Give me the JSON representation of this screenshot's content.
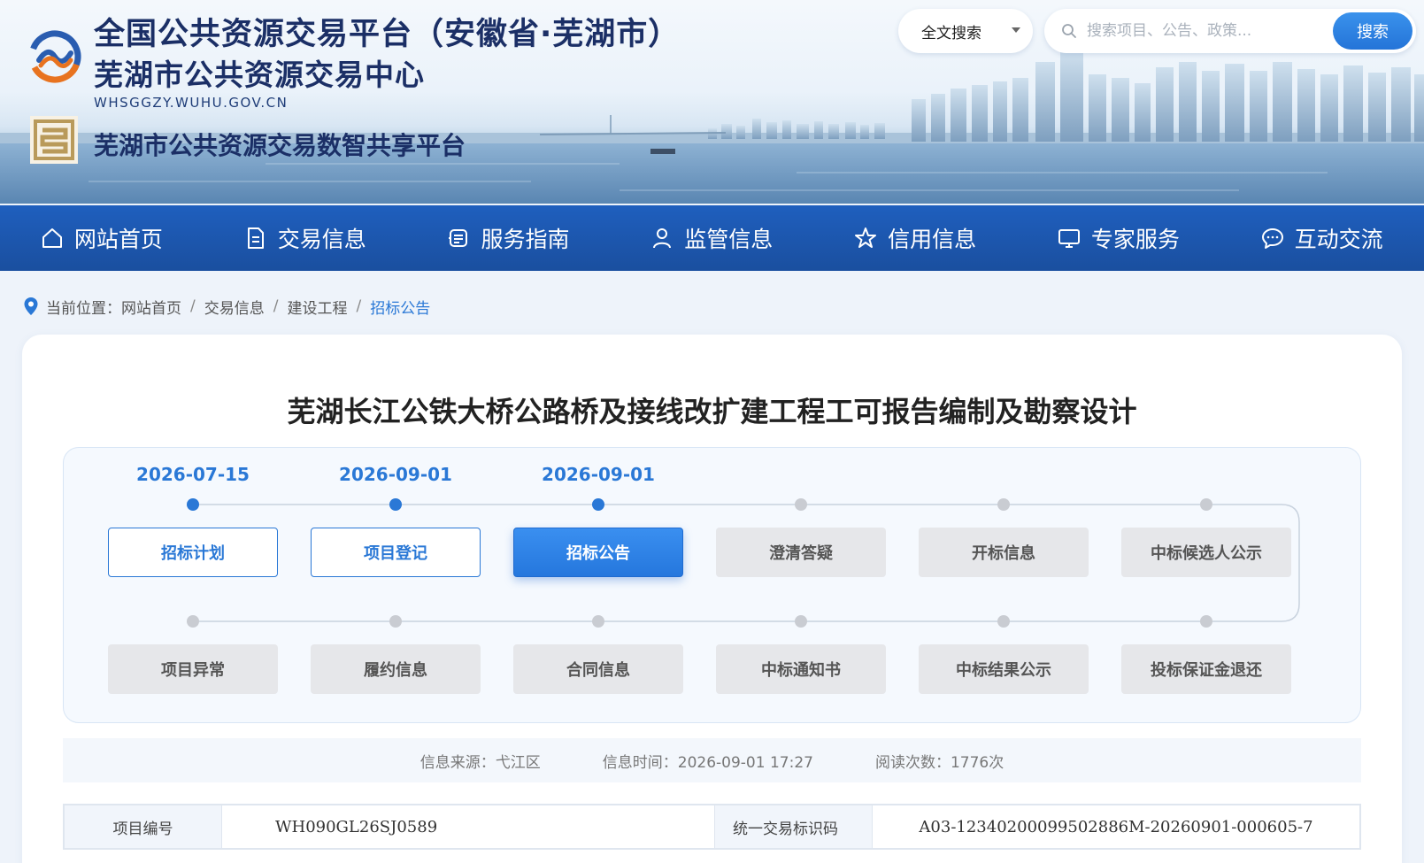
{
  "header": {
    "title_main": "全国公共资源交易平台（安徽省·芜湖市）",
    "title_sub": "芜湖市公共资源交易中心",
    "domain": "WHSGGZY.WUHU.GOV.CN",
    "title_share": "芜湖市公共资源交易数智共享平台"
  },
  "search": {
    "type_label": "全文搜索",
    "placeholder": "搜索项目、公告、政策...",
    "button_label": "搜索"
  },
  "nav": {
    "items": [
      {
        "label": "网站首页",
        "icon": "home-icon"
      },
      {
        "label": "交易信息",
        "icon": "document-icon"
      },
      {
        "label": "服务指南",
        "icon": "guide-icon"
      },
      {
        "label": "监管信息",
        "icon": "user-icon"
      },
      {
        "label": "信用信息",
        "icon": "star-icon"
      },
      {
        "label": "专家服务",
        "icon": "monitor-icon"
      },
      {
        "label": "互动交流",
        "icon": "chat-icon"
      }
    ]
  },
  "breadcrumb": {
    "prefix": "当前位置：",
    "items": [
      "网站首页",
      "交易信息",
      "建设工程"
    ],
    "current": "招标公告",
    "separator": "/"
  },
  "document": {
    "title": "芜湖长江公铁大桥公路桥及接线改扩建工程工可报告编制及勘察设计"
  },
  "flow": {
    "row1": [
      {
        "label": "招标计划",
        "date": "2026-07-15",
        "state": "done"
      },
      {
        "label": "项目登记",
        "date": "2026-09-01",
        "state": "done"
      },
      {
        "label": "招标公告",
        "date": "2026-09-01",
        "state": "active"
      },
      {
        "label": "澄清答疑",
        "date": "",
        "state": "todo"
      },
      {
        "label": "开标信息",
        "date": "",
        "state": "todo"
      },
      {
        "label": "中标候选人公示",
        "date": "",
        "state": "todo"
      }
    ],
    "row2": [
      {
        "label": "项目异常",
        "state": "todo"
      },
      {
        "label": "履约信息",
        "state": "todo"
      },
      {
        "label": "合同信息",
        "state": "todo"
      },
      {
        "label": "中标通知书",
        "state": "todo"
      },
      {
        "label": "中标结果公示",
        "state": "todo"
      },
      {
        "label": "投标保证金退还",
        "state": "todo"
      }
    ]
  },
  "meta": {
    "source": "信息来源：弋江区",
    "time": "信息时间：2026-09-01 17:27",
    "views": "阅读次数：1776次"
  },
  "info": {
    "project_no_label": "项目编号",
    "project_no": "WH090GL26SJ0589",
    "trade_code_label": "统一交易标识码",
    "trade_code": "A03-12340200099502886M-20260901-000605-7"
  },
  "colors": {
    "nav_bg": "#1a55a8",
    "accent": "#2a78d6",
    "title_dark": "#1b2f66",
    "inactive_step": "#e6e7ea"
  }
}
